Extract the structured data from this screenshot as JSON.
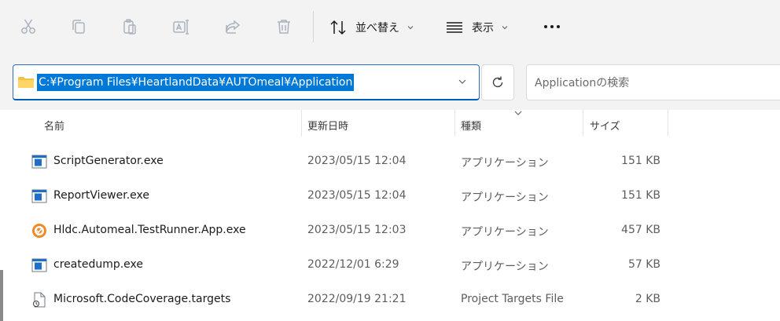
{
  "toolbar": {
    "sort_label": "並べ替え",
    "view_label": "表示"
  },
  "address": {
    "path": "C:¥Program Files¥HeartlandData¥AUTOmeal¥Application",
    "search_placeholder": "Applicationの検索"
  },
  "columns": {
    "name": "名前",
    "date": "更新日時",
    "type": "種類",
    "size": "サイズ"
  },
  "files": [
    {
      "name": "ScriptGenerator.exe",
      "date": "2023/05/15 12:04",
      "type": "アプリケーション",
      "size": "151 KB",
      "icon": "app-window-icon"
    },
    {
      "name": "ReportViewer.exe",
      "date": "2023/05/15 12:04",
      "type": "アプリケーション",
      "size": "151 KB",
      "icon": "app-window-icon"
    },
    {
      "name": "Hldc.Automeal.TestRunner.App.exe",
      "date": "2023/05/15 12:03",
      "type": "アプリケーション",
      "size": "457 KB",
      "icon": "target-app-icon"
    },
    {
      "name": "createdump.exe",
      "date": "2022/12/01 6:29",
      "type": "アプリケーション",
      "size": "57 KB",
      "icon": "app-window-icon"
    },
    {
      "name": "Microsoft.CodeCoverage.targets",
      "date": "2022/09/19 21:21",
      "type": "Project Targets File",
      "size": "2 KB",
      "icon": "script-file-icon"
    }
  ],
  "colors": {
    "accent": "#0078d7",
    "toolbar_bg": "#f3f3f3",
    "disabled_icon": "#a9b3bd",
    "app_icon_blue": "#1f6fc5",
    "target_icon_orange": "#f08a24"
  }
}
